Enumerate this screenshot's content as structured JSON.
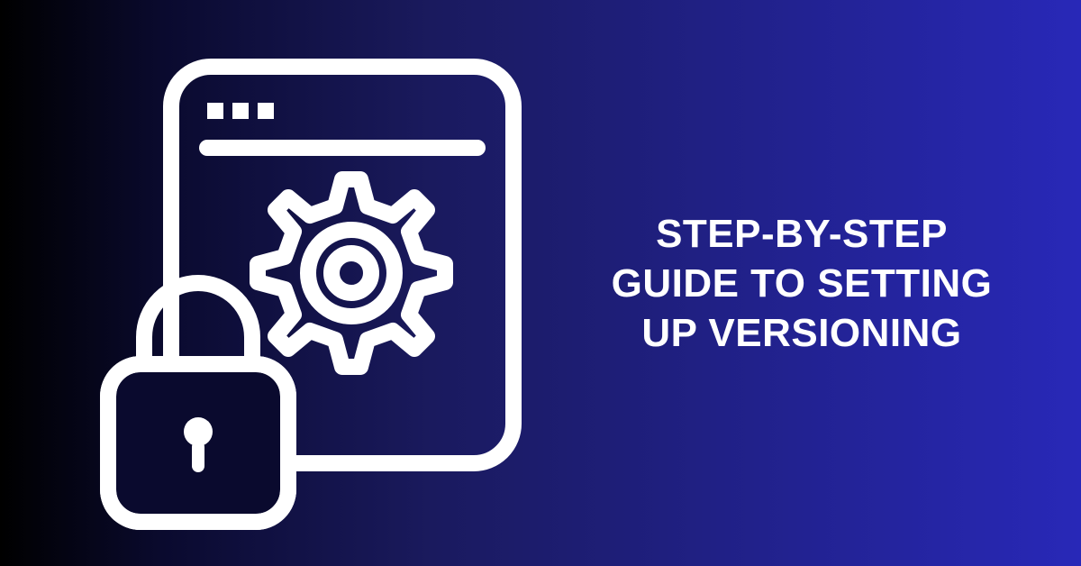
{
  "headline": "STEP-BY-STEP GUIDE TO SETTING UP VERSIONING",
  "colors": {
    "stroke": "#ffffff",
    "bg_gradient_start": "#000000",
    "bg_gradient_end": "#2828b8"
  },
  "icons": {
    "browser_window": "browser-window-icon",
    "gear": "gear-icon",
    "lock": "lock-icon"
  }
}
